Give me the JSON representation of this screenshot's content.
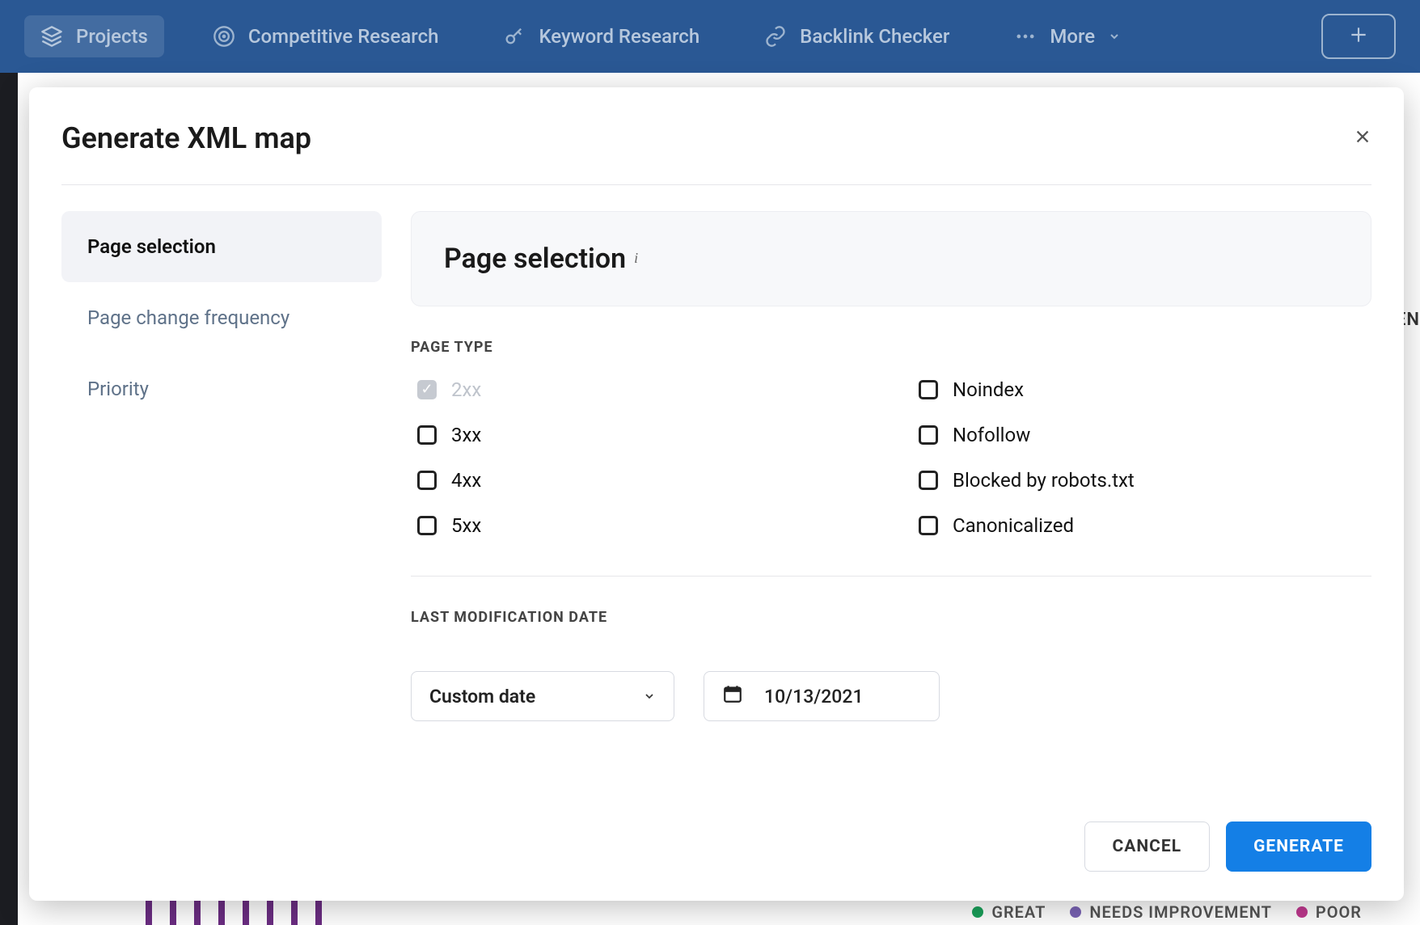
{
  "nav": {
    "items": [
      {
        "label": "Projects",
        "active": true
      },
      {
        "label": "Competitive Research",
        "active": false
      },
      {
        "label": "Keyword Research",
        "active": false
      },
      {
        "label": "Backlink Checker",
        "active": false
      },
      {
        "label": "More",
        "active": false
      }
    ]
  },
  "modal": {
    "title": "Generate XML map",
    "tabs": [
      {
        "label": "Page selection",
        "active": true
      },
      {
        "label": "Page change frequency",
        "active": false
      },
      {
        "label": "Priority",
        "active": false
      }
    ],
    "panel_title": "Page selection",
    "page_type_label": "PAGE TYPE",
    "page_types": {
      "col1": [
        {
          "label": "2xx",
          "checked": true,
          "disabled": true
        },
        {
          "label": "3xx",
          "checked": false,
          "disabled": false
        },
        {
          "label": "4xx",
          "checked": false,
          "disabled": false
        },
        {
          "label": "5xx",
          "checked": false,
          "disabled": false
        }
      ],
      "col2": [
        {
          "label": "Noindex",
          "checked": false,
          "disabled": false
        },
        {
          "label": "Nofollow",
          "checked": false,
          "disabled": false
        },
        {
          "label": "Blocked by robots.txt",
          "checked": false,
          "disabled": false
        },
        {
          "label": "Canonicalized",
          "checked": false,
          "disabled": false
        }
      ]
    },
    "last_mod_label": "LAST MODIFICATION DATE",
    "date_select_value": "Custom date",
    "date_input_value": "10/13/2021",
    "cancel_label": "CANCEL",
    "generate_label": "GENERATE"
  },
  "background": {
    "sen_fragment": "SEN",
    "legend": [
      {
        "label": "GREAT",
        "color": "#1aa05a"
      },
      {
        "label": "NEEDS IMPROVEMENT",
        "color": "#7a63b5"
      },
      {
        "label": "POOR",
        "color": "#c0398f"
      }
    ]
  }
}
